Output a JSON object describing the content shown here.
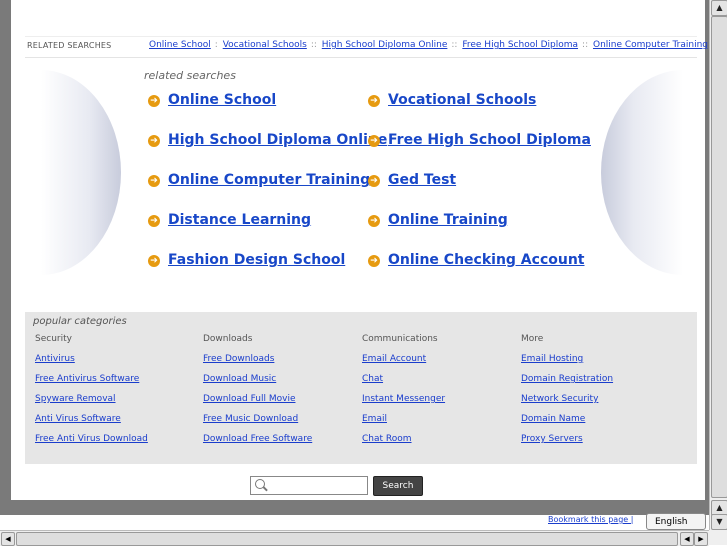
{
  "related_bar": {
    "label": "RELATED SEARCHES",
    "links": [
      "Online School",
      "Vocational Schools",
      "High School Diploma Online",
      "Free High School Diploma",
      "Online Computer Training"
    ]
  },
  "related": {
    "title": "related searches",
    "items": [
      "Online School",
      "Vocational Schools",
      "High School Diploma Online",
      "Free High School Diploma",
      "Online Computer Training",
      "Ged Test",
      "Distance Learning",
      "Online Training",
      "Fashion Design School",
      "Online Checking Account"
    ]
  },
  "popular": {
    "title": "popular categories",
    "columns": [
      {
        "head": "Security",
        "links": [
          "Antivirus",
          "Free Antivirus Software",
          "Spyware Removal",
          "Anti Virus Software",
          "Free Anti Virus Download"
        ]
      },
      {
        "head": "Downloads",
        "links": [
          "Free Downloads",
          "Download Music",
          "Download Full Movie",
          "Free Music Download",
          "Download Free Software"
        ]
      },
      {
        "head": "Communications",
        "links": [
          "Email Account",
          "Chat",
          "Instant Messenger",
          "Email",
          "Chat Room"
        ]
      },
      {
        "head": "More",
        "links": [
          "Email Hosting",
          "Domain Registration",
          "Network Security",
          "Domain Name",
          "Proxy Servers"
        ]
      }
    ]
  },
  "search": {
    "button_label": "Search",
    "value": ""
  },
  "footer": {
    "bookmark": "Bookmark this page |",
    "language": "English"
  },
  "icons": {
    "arrow": "arrow-right-circle-icon",
    "search": "magnifier-icon"
  },
  "colors": {
    "link": "#1a3dcc",
    "arrow": "#e69a10",
    "panel": "#e6e6e6"
  }
}
